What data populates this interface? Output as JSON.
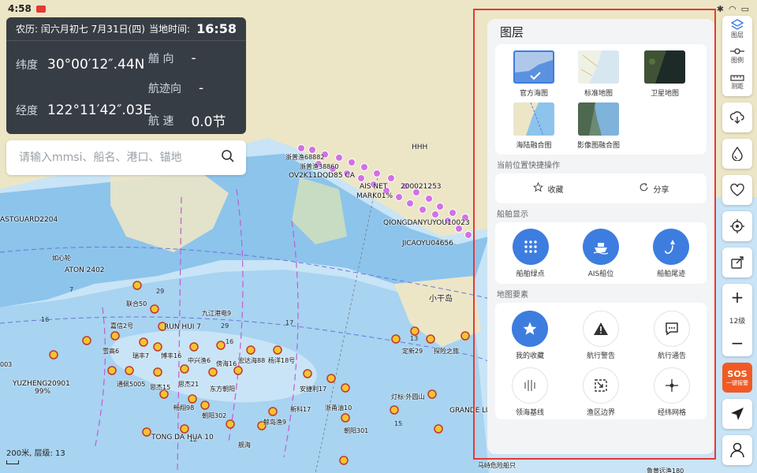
{
  "status_bar": {
    "time": "4:58"
  },
  "info_panel": {
    "lunar_date": "农历: 闰六月初七  7月31日(四)",
    "local_time_label": "当地时间:",
    "local_time": "16:58",
    "lat_label": "纬度",
    "lat_value": "30°00′12″.44N",
    "lon_label": "经度",
    "lon_value": "122°11′42″.03E",
    "heading_label": "艏   向",
    "heading_value": "-",
    "track_label": "航迹向",
    "track_value": "-",
    "speed_label": "航   速",
    "speed_value": "0.0节"
  },
  "search": {
    "placeholder": "请输入mmsi、船名、港口、锚地"
  },
  "scale": {
    "text": "200米, 层级: 13"
  },
  "map_labels": {
    "coastguard": "ASTGUARD2204",
    "ship1": "OV2K11DQD85 CA",
    "ship2": "浙普渔68882",
    "ship3": "浙普渔38860",
    "ais": "AIS NET",
    "ais2": "MARK01%",
    "num": "200021253",
    "hhh": "HHH",
    "qiong": "QIONGDANYUYOU10023",
    "jicao": "JICAOYU04656",
    "xiao": "小干岛",
    "ruyi": "如心轮",
    "aton": "ATON 2402",
    "lianhe": "联合50",
    "jiujiang": "九江港电9",
    "jiaxin": "嘉信2号",
    "runhui": "RUN HUI 7",
    "xuegao": "雪高6",
    "ruifeng": "瑞丰7",
    "bofeng": "博丰16",
    "zhongxing": "中兴渔6",
    "chenghai": "傍海16",
    "hongda": "宏达海88",
    "qiaoyang": "杨洋18号",
    "dingxin": "定新29",
    "tanxian": "探险之旅",
    "yuzheng": "YUZHENG20901",
    "yuzheng_pct": "99%",
    "tongji": "通佩5005",
    "siyuan": "思杰15",
    "siyuan2": "思杰21",
    "dongfang": "东方朝阳",
    "anjie": "安捷利17",
    "xinke": "新科17",
    "zheyong": "浙甬油10",
    "lingfeng": "灯标·外圆山",
    "grande": "GRANDE LU",
    "changchun": "畅翔98",
    "chaoyang": "朝阳302",
    "xinglan": "鲸岛渔9",
    "tongda": "TONG DA HUA 10",
    "zhaoyang": "朝阳301",
    "daodao": "舰海",
    "num003": "003",
    "mazhou": "马峙危险船只",
    "luyou": "鲁黄远渔180"
  },
  "toolbar": {
    "layers_label": "图层",
    "legend_label": "图例",
    "measure_label": "测距",
    "zoom_level": "12级",
    "sos_label": "SOS",
    "sos_sub": "一键报警"
  },
  "layer_panel": {
    "title": "图层",
    "map_types": [
      {
        "label": "官方海图",
        "selected": true
      },
      {
        "label": "标准地图",
        "selected": false
      },
      {
        "label": "卫星地图",
        "selected": false
      },
      {
        "label": "海陆融合图",
        "selected": false
      },
      {
        "label": "影像图融合图",
        "selected": false
      }
    ],
    "quick_section": "当前位置快捷操作",
    "favorite_label": "收藏",
    "share_label": "分享",
    "ship_section": "船舶显示",
    "ship_options": [
      {
        "label": "船舶绿点"
      },
      {
        "label": "AIS船位"
      },
      {
        "label": "船舶尾迹"
      }
    ],
    "elements_section": "地图要素",
    "elements": [
      {
        "label": "我的收藏",
        "icon": "star-icon",
        "active": true
      },
      {
        "label": "航行警告",
        "icon": "warning-icon",
        "active": false
      },
      {
        "label": "航行通告",
        "icon": "notice-icon",
        "active": false
      },
      {
        "label": "领海基线",
        "icon": "baseline-icon",
        "active": false
      },
      {
        "label": "渔区边界",
        "icon": "fishing-boundary-icon",
        "active": false
      },
      {
        "label": "经纬网格",
        "icon": "grid-icon",
        "active": false
      }
    ]
  },
  "colors": {
    "land": "#ece6c6",
    "shallow_water": "#8cc4ec",
    "deep_water": "#c8e4f6",
    "accent": "#3d7de0",
    "frame": "#e53935",
    "sos": "#f15a24"
  }
}
